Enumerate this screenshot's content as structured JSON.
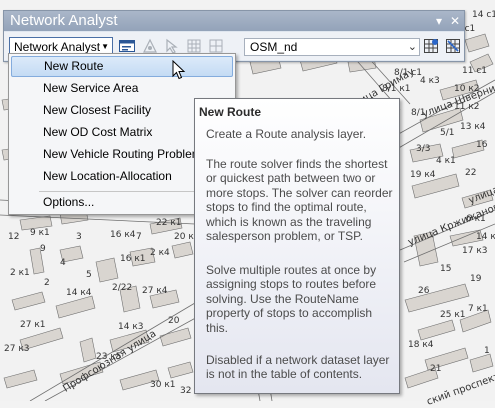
{
  "window": {
    "title": "Network Analyst",
    "pin_glyph": "▾",
    "close_glyph": "✕"
  },
  "toolbar": {
    "menu_label": "Network Analyst",
    "dataset": "OSM_nd"
  },
  "menu": {
    "items": [
      {
        "label": "New Route"
      },
      {
        "label": "New Service Area"
      },
      {
        "label": "New Closest Facility"
      },
      {
        "label": "New OD Cost Matrix"
      },
      {
        "label": "New Vehicle Routing Problem"
      },
      {
        "label": "New Location-Allocation"
      },
      {
        "label": "Options..."
      }
    ]
  },
  "tooltip": {
    "title": "New Route",
    "paragraphs": [
      "Create a Route analysis layer.",
      "The route solver finds the shortest or quickest path between two or more stops. The solver can reorder stops to find the optimal route, which is known as the traveling salesperson problem, or TSP.",
      "Solve multiple routes at once by assigning stops to routes before solving. Use the RouteName property of stops to accomplish this.",
      "Disabled if a network dataset layer is not in the table of contents."
    ]
  },
  "map": {
    "labels": [
      "улица Шверника",
      "улица Гримау",
      "улица Кржижановского",
      "улица",
      "Профсоюзная улица",
      "ский проспект",
      "8/1 с1",
      "8/1 к1",
      "11 с1",
      "13 к4",
      "19 к4",
      "22",
      "16 к4",
      "23 к5",
      "27 к4",
      "27 к1",
      "27 к3",
      "5/1",
      "2/22",
      "14 к4",
      "8/1",
      "10",
      "4 к3",
      "12",
      "2 к1",
      "2",
      "2 к4",
      "7",
      "20 к3",
      "3",
      "20",
      "9 к1",
      "9",
      "4",
      "5",
      "14 к3",
      "16 к1",
      "22 к1",
      "10 к2",
      "11 к2",
      "26",
      "25 к1",
      "19",
      "18 к4",
      "17 к3",
      "15",
      "7 к1",
      "3/3",
      "16",
      "4 к1",
      "6 к1",
      "14 с1",
      "2 с1",
      "1",
      "21",
      "30 к1",
      "32",
      "14 к2"
    ],
    "colors": {
      "building": "#d9d5d0",
      "road": "#ffffff",
      "outline": "#6f6f6f"
    }
  }
}
